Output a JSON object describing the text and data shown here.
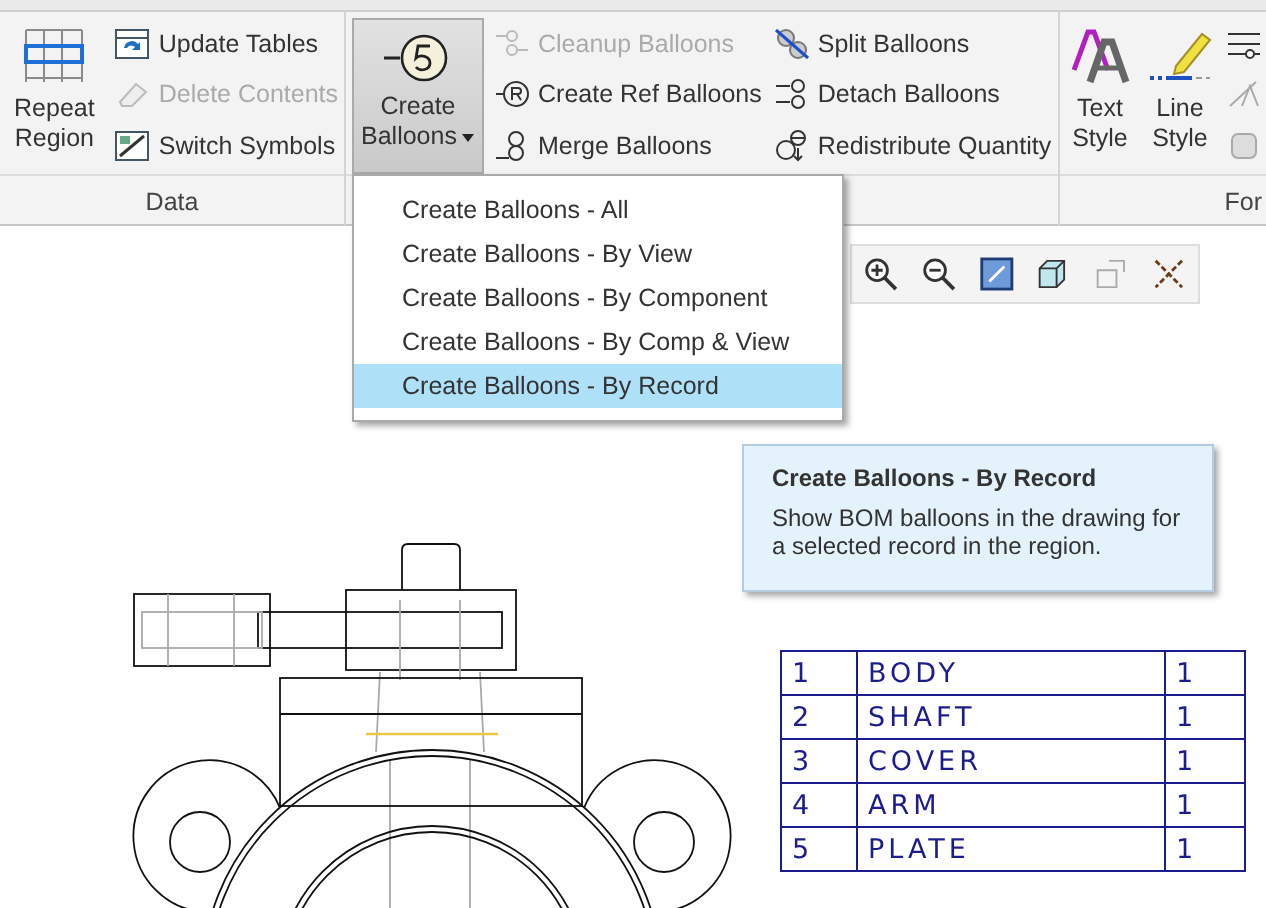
{
  "ribbon": {
    "data_group": {
      "label": "Data",
      "large_button": {
        "label": "Repeat Region"
      },
      "small_buttons": [
        {
          "label": "Update Tables",
          "disabled": false
        },
        {
          "label": "Delete Contents",
          "disabled": true
        },
        {
          "label": "Switch Symbols",
          "disabled": false
        }
      ]
    },
    "balloon_group": {
      "create_button": {
        "label": "Create Balloons",
        "pressed": true
      },
      "small_buttons": [
        {
          "label": "Cleanup Balloons",
          "disabled": true
        },
        {
          "label": "Create Ref Balloons",
          "disabled": false
        },
        {
          "label": "Merge Balloons",
          "disabled": false
        },
        {
          "label": "Split Balloons",
          "disabled": false
        },
        {
          "label": "Detach Balloons",
          "disabled": false
        },
        {
          "label": "Redistribute Quantity",
          "disabled": false
        }
      ]
    },
    "format_group": {
      "label": "For",
      "buttons": [
        {
          "label": "Text Style"
        },
        {
          "label": "Line Style"
        }
      ]
    }
  },
  "dropdown_menu": {
    "items": [
      {
        "label": "Create Balloons - All",
        "selected": false
      },
      {
        "label": "Create Balloons - By View",
        "selected": false
      },
      {
        "label": "Create Balloons - By Component",
        "selected": false
      },
      {
        "label": "Create Balloons - By Comp & View",
        "selected": false
      },
      {
        "label": "Create Balloons - By Record",
        "selected": true
      }
    ]
  },
  "tooltip": {
    "title": "Create Balloons - By Record",
    "text": "Show BOM balloons in the drawing for a selected record in the region."
  },
  "bom_table": {
    "rows": [
      {
        "index": "1",
        "name": "BODY",
        "quantity": "1"
      },
      {
        "index": "2",
        "name": "SHAFT",
        "quantity": "1"
      },
      {
        "index": "3",
        "name": "COVER",
        "quantity": "1"
      },
      {
        "index": "4",
        "name": "ARM",
        "quantity": "1"
      },
      {
        "index": "5",
        "name": "PLATE",
        "quantity": "1"
      }
    ]
  }
}
